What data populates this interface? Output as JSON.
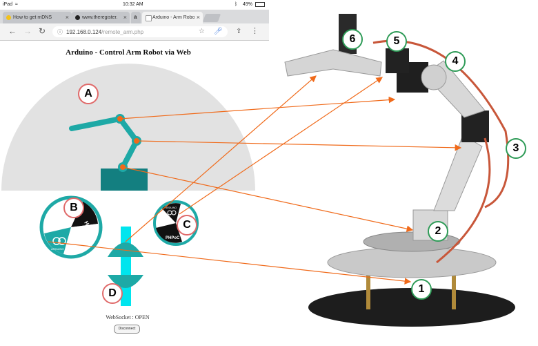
{
  "status": {
    "device": "iPad",
    "time": "10:32 AM",
    "battery": "49%"
  },
  "tabs": [
    {
      "label": "How to get mDNS",
      "active": false
    },
    {
      "label": "www.theregister.",
      "active": false
    },
    {
      "label": "a",
      "active": false
    },
    {
      "label": "Arduino - Arm Robot",
      "active": true
    }
  ],
  "url": {
    "host": "192.168.0.124",
    "path": "/remote_arm.php"
  },
  "page": {
    "title": "Arduino - Control Arm Robot via Web",
    "websocket_status": "WebSocket : OPEN",
    "disconnect_label": "Disconnect"
  },
  "labels": [
    "A",
    "B",
    "C",
    "D"
  ],
  "wheel_texts": {
    "b_black": "Hd",
    "b_teal": "ARDUINO",
    "c_black": "PHPoC",
    "c_white": "ARDUINO"
  },
  "servos": [
    "1",
    "2",
    "3",
    "4",
    "5",
    "6"
  ],
  "colors": {
    "teal": "#1ea9a6",
    "dark_teal": "#137f80",
    "joint": "#f06a1a",
    "arrow": "#f06a1a",
    "cyan": "#00e5ee",
    "label_ring": "#e06a6a",
    "servo_ring": "#2e9b57"
  }
}
